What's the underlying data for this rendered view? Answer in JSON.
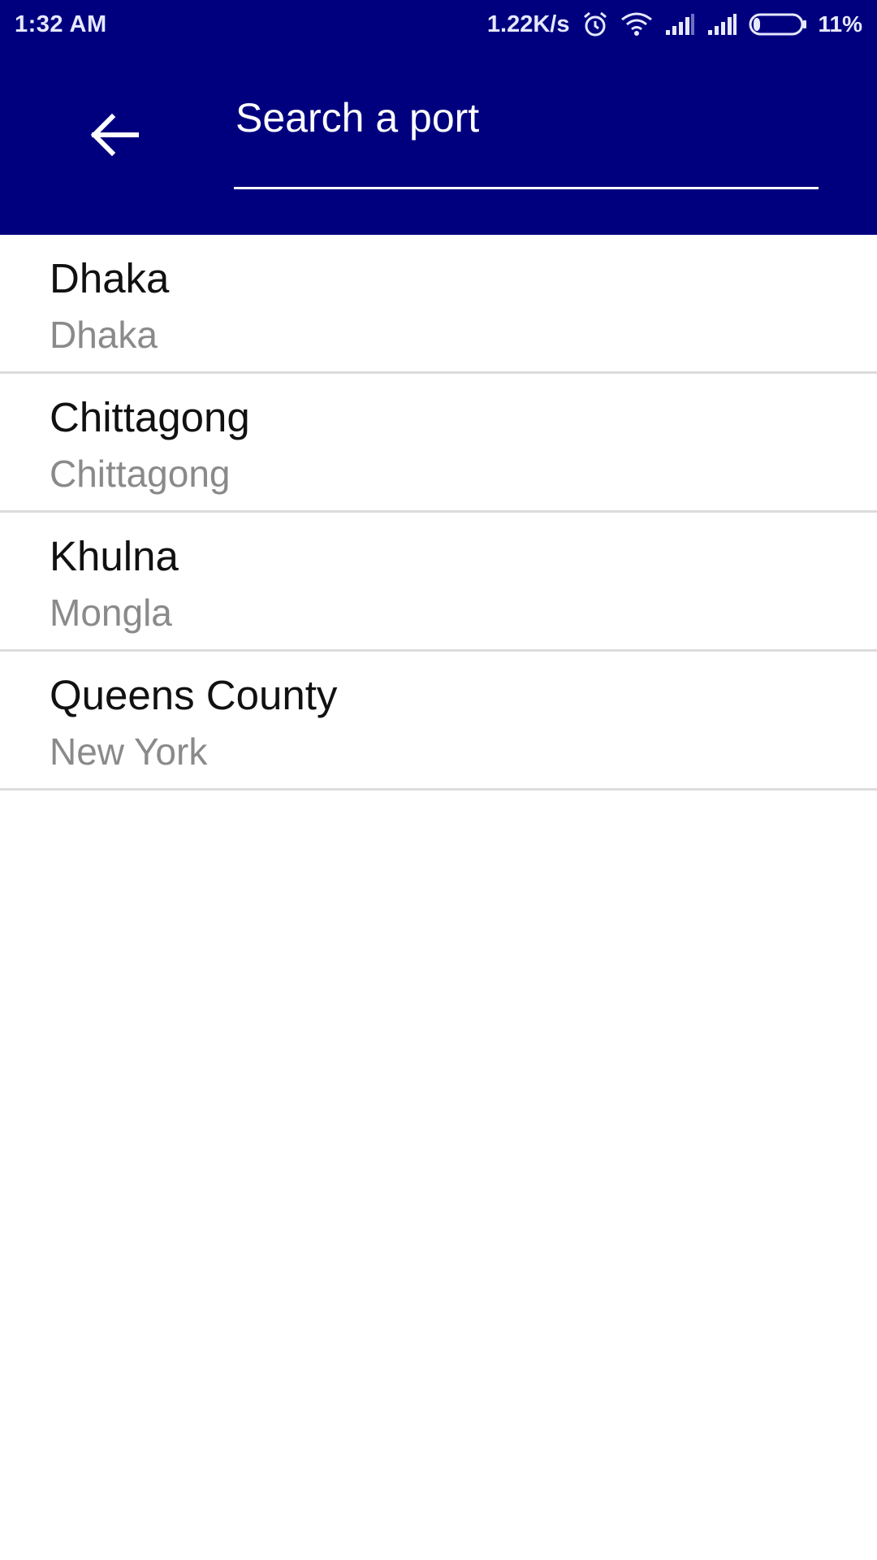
{
  "status_bar": {
    "time": "1:32 AM",
    "network_speed": "1.22K/s",
    "battery_percent": "11%",
    "icons": [
      "alarm-icon",
      "wifi-icon",
      "signal-icon",
      "signal-icon",
      "battery-icon"
    ]
  },
  "toolbar": {
    "back_icon": "arrow-left-icon",
    "search_placeholder": "Search a port",
    "background_color": "#00007f"
  },
  "ports": [
    {
      "name": "Dhaka",
      "city": "Dhaka"
    },
    {
      "name": "Chittagong",
      "city": "Chittagong"
    },
    {
      "name": "Khulna",
      "city": "Mongla"
    },
    {
      "name": "Queens County",
      "city": "New York"
    }
  ]
}
